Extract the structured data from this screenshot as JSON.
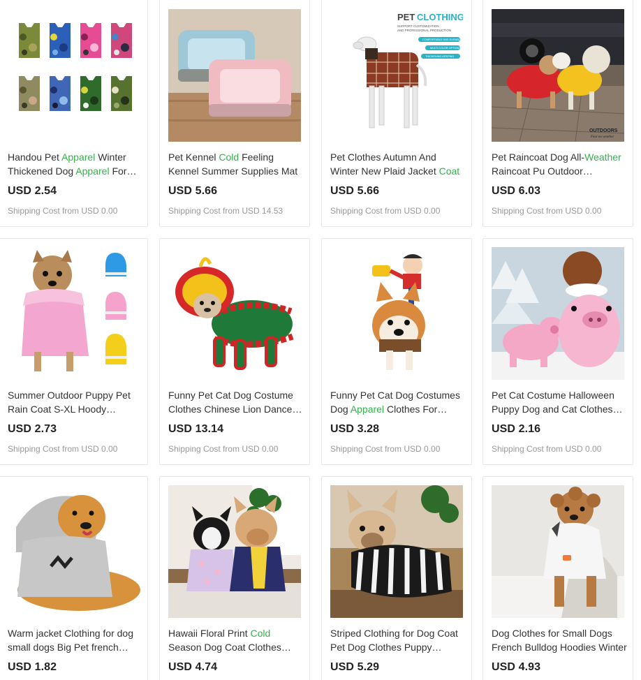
{
  "products": [
    {
      "title_parts": [
        [
          "Handou Pet ",
          false
        ],
        [
          "Apparel",
          true
        ],
        [
          " Winter Thickened Dog ",
          false
        ],
        [
          "Apparel",
          true
        ],
        [
          " For Small Dogs",
          false
        ]
      ],
      "price": "USD 2.54",
      "shipping": "Shipping Cost from USD 0.00",
      "image": "camo-vests-icon"
    },
    {
      "title_parts": [
        [
          "Pet Kennel ",
          false
        ],
        [
          "Cold",
          true
        ],
        [
          " Feeling Kennel Summer Supplies Mat",
          false
        ]
      ],
      "price": "USD 5.66",
      "shipping": "Shipping Cost from USD 14.53",
      "image": "pet-beds-icon"
    },
    {
      "title_parts": [
        [
          "Pet Clothes Autumn And Winter New Plaid Jacket ",
          false
        ],
        [
          "Coat",
          true
        ]
      ],
      "price": "USD 5.66",
      "shipping": "Shipping Cost from USD 0.00",
      "image": "plaid-jacket-icon",
      "image_text": {
        "heading_a": "PET",
        "heading_b": "CLOTHING",
        "sub1": "SUPPORT CUSTOMIZATION",
        "sub2": "AND PROFESSIONAL PRODUCTION",
        "tag1": "COMFORTABLE AND DURABLE",
        "tag2": "MULTI COLOR OPTIONS",
        "tag3": "THICKENING KEEPING"
      }
    },
    {
      "title_parts": [
        [
          "Pet Raincoat Dog All-",
          false
        ],
        [
          "Weather",
          true
        ],
        [
          " Raincoat Pu Outdoor Waterproof",
          false
        ]
      ],
      "price": "USD 6.03",
      "shipping": "Shipping Cost from USD 0.00",
      "image": "raincoat-dogs-icon",
      "image_text": {
        "label1": "OUTDOORS",
        "label2": "Fear no weather"
      }
    },
    {
      "title_parts": [
        [
          "Summer Outdoor Puppy Pet Rain Coat S-XL Hoody Waterproof",
          false
        ]
      ],
      "price": "USD 2.73",
      "shipping": "Shipping Cost from USD 0.00",
      "image": "pink-raincoat-icon"
    },
    {
      "title_parts": [
        [
          "Funny Pet Cat Dog Costume Clothes Chinese Lion Dance Outfit",
          false
        ]
      ],
      "price": "USD 13.14",
      "shipping": "Shipping Cost from USD 0.00",
      "image": "lion-costume-icon"
    },
    {
      "title_parts": [
        [
          "Funny Pet Cat Dog Costumes Dog ",
          false
        ],
        [
          "Apparel",
          true
        ],
        [
          " Clothes For Halloween",
          false
        ]
      ],
      "price": "USD 3.28",
      "shipping": "Shipping Cost from USD 0.00",
      "image": "cowboy-rider-icon"
    },
    {
      "title_parts": [
        [
          "Pet Cat Costume Halloween Puppy Dog and Cat Clothes Pig",
          false
        ]
      ],
      "price": "USD 2.16",
      "shipping": "Shipping Cost from USD 0.00",
      "image": "pig-costume-icon"
    },
    {
      "title_parts": [
        [
          "Warm jacket Clothing for dog small dogs Big Pet french bulldog",
          false
        ]
      ],
      "price": "USD 1.82",
      "shipping": "",
      "image": "gray-hoodie-icon"
    },
    {
      "title_parts": [
        [
          "Hawaii Floral Print ",
          false
        ],
        [
          "Cold",
          true
        ],
        [
          " Season Dog Coat Clothes Bulldog",
          false
        ]
      ],
      "price": "USD 4.74",
      "shipping": "",
      "image": "floral-bulldogs-icon"
    },
    {
      "title_parts": [
        [
          "Striped Clothing for Dog Coat Pet Dog Clothes Puppy Sweater",
          false
        ]
      ],
      "price": "USD 5.29",
      "shipping": "",
      "image": "striped-sweater-icon"
    },
    {
      "title_parts": [
        [
          "Dog Clothes for Small Dogs French Bulldog Hoodies Winter",
          false
        ]
      ],
      "price": "USD 4.93",
      "shipping": "",
      "image": "white-hoodie-icon"
    }
  ]
}
